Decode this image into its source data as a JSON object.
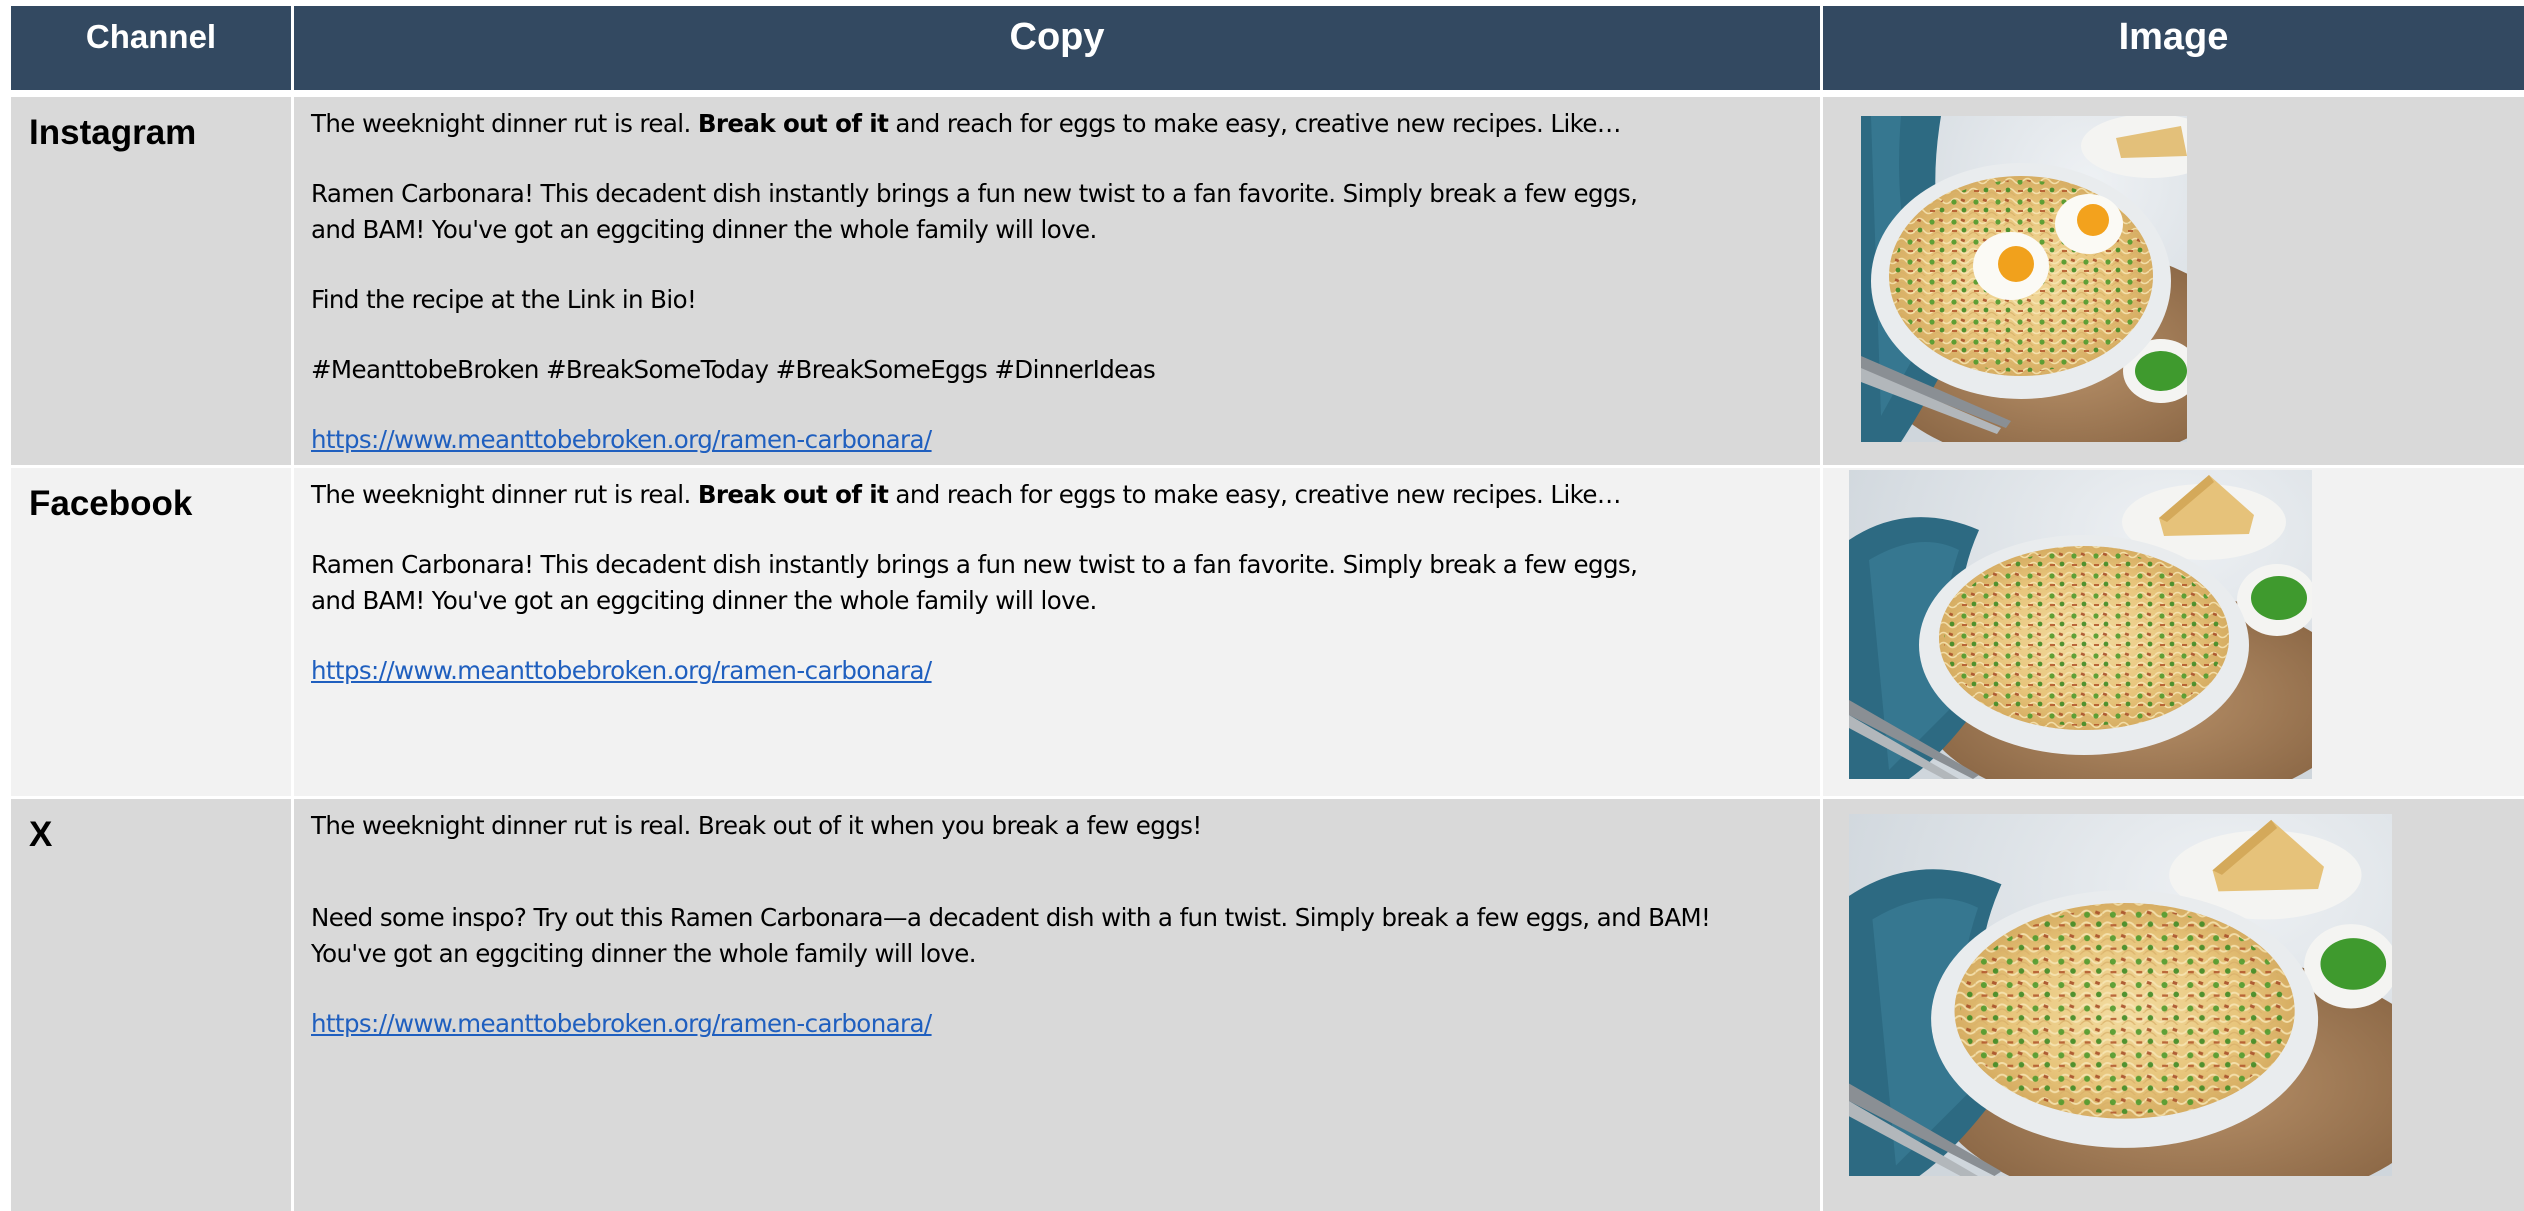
{
  "header": {
    "channel_label": "Channel",
    "copy_label": "Copy",
    "image_label": "Image"
  },
  "rows": [
    {
      "channel": "Instagram",
      "line1_pre": "The weeknight dinner rut is real. ",
      "line1_bold": "Break out of it",
      "line1_post": " and reach for eggs to make easy, creative new recipes. Like…",
      "para2_line1": "Ramen Carbonara! This decadent dish instantly brings a fun new twist to a fan favorite. Simply break a few eggs,",
      "para2_line2": "and BAM! You've got an eggciting dinner the whole family will love.",
      "para3": "Find the recipe at the Link in Bio!",
      "para4": "#MeanttobeBroken #BreakSomeToday #BreakSomeEggs #DinnerIdeas",
      "link": "https://www.meanttobebroken.org/ramen-carbonara/",
      "image_icon": "ramen-carbonara-with-eggs-photo"
    },
    {
      "channel": "Facebook",
      "line1_pre": "The weeknight dinner rut is real. ",
      "line1_bold": "Break out of it",
      "line1_post": " and reach for eggs to make easy, creative new recipes. Like…",
      "para2_line1": "Ramen Carbonara! This decadent dish instantly brings a fun new twist to a fan favorite. Simply break a few eggs,",
      "para2_line2": "and BAM! You've got an eggciting dinner the whole family will love.",
      "link": "https://www.meanttobebroken.org/ramen-carbonara/",
      "image_icon": "ramen-carbonara-bowl-photo"
    },
    {
      "channel": "X",
      "line1": "The weeknight dinner rut is real. Break out of it when you break a few eggs!",
      "para2_line1": "Need some inspo? Try out this Ramen Carbonara—a decadent dish with a fun twist. Simply break a few eggs, and BAM!",
      "para2_line2": "You've got an eggciting dinner the whole family will love.",
      "link": "https://www.meanttobebroken.org/ramen-carbonara/",
      "image_icon": "ramen-carbonara-bowl-photo"
    }
  ],
  "colors": {
    "header_bg": "#334961",
    "row_dark": "#d9d9d9",
    "row_light": "#f2f2f2",
    "link": "#1f5fbf"
  }
}
